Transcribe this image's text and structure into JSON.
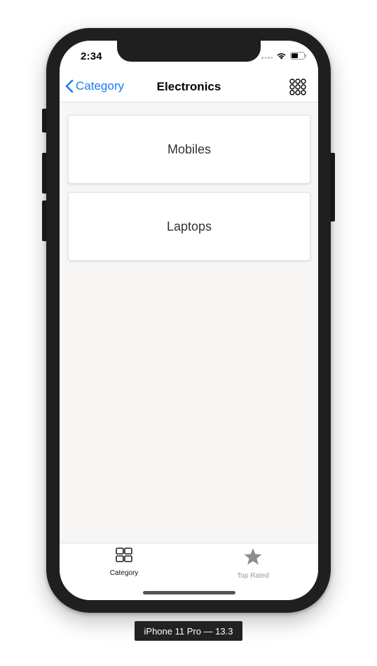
{
  "status_bar": {
    "time": "2:34"
  },
  "nav": {
    "back_label": "Category",
    "title": "Electronics",
    "menu_icon": "grid-dots-icon"
  },
  "cards": [
    {
      "label": "Mobiles"
    },
    {
      "label": "Laptops"
    }
  ],
  "tab_bar": {
    "tabs": [
      {
        "label": "Category",
        "icon": "grid-squares-icon",
        "selected": true
      },
      {
        "label": "Top Rated",
        "icon": "star-icon",
        "selected": false
      }
    ]
  },
  "device_label": "iPhone 11 Pro — 13.3",
  "colors": {
    "accent": "#1b7cf5",
    "background": "#f8f5f5",
    "frame": "#1f1f1f",
    "inactive_tab": "#9a9a9a"
  }
}
